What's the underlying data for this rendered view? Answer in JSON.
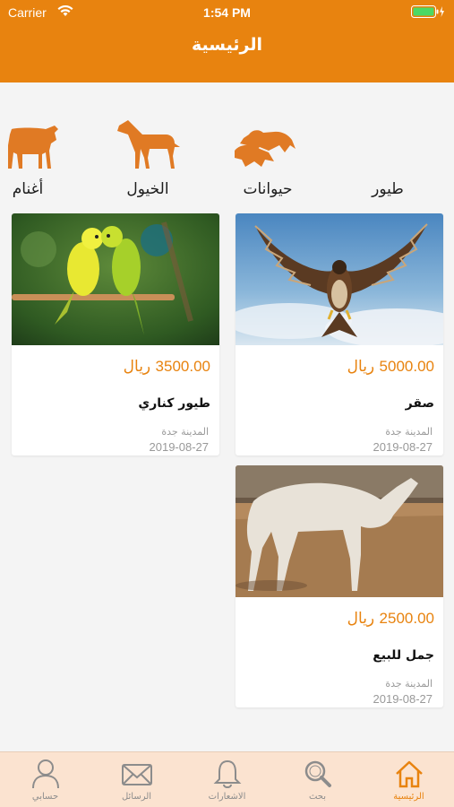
{
  "status_bar": {
    "carrier": "Carrier",
    "time": "1:54 PM"
  },
  "header": {
    "title": "الرئيسية"
  },
  "categories": [
    {
      "label": "طيور",
      "icon": "bird-icon"
    },
    {
      "label": "حيوانات",
      "icon": "animals-icon"
    },
    {
      "label": "الخيول",
      "icon": "horse-icon"
    },
    {
      "label": "أغنام",
      "icon": "sheep-icon"
    }
  ],
  "listings": [
    {
      "price": "5000.00",
      "currency": "ريال",
      "name": "صقر",
      "city": "المدينة جدة",
      "date": "2019-08-27",
      "image": "falcon-photo"
    },
    {
      "price": "3500.00",
      "currency": "ريال",
      "name": "طيور كناري",
      "city": "المدينة جدة",
      "date": "2019-08-27",
      "image": "parrots-photo"
    },
    {
      "price": "2500.00",
      "currency": "ريال",
      "name": "جمل للبيع",
      "city": "المدينة جدة",
      "date": "2019-08-27",
      "image": "camel-photo"
    }
  ],
  "tabbar": [
    {
      "label": "الرئيسية",
      "icon": "home-icon",
      "active": true
    },
    {
      "label": "بحث",
      "icon": "search-icon",
      "active": false
    },
    {
      "label": "الاشعارات",
      "icon": "bell-icon",
      "active": false
    },
    {
      "label": "الرسائل",
      "icon": "envelope-icon",
      "active": false
    },
    {
      "label": "حسابي",
      "icon": "user-icon",
      "active": false
    }
  ],
  "colors": {
    "accent": "#e8830f",
    "tabbar_bg": "#fbe3d0",
    "page_bg": "#f4f4f4"
  }
}
